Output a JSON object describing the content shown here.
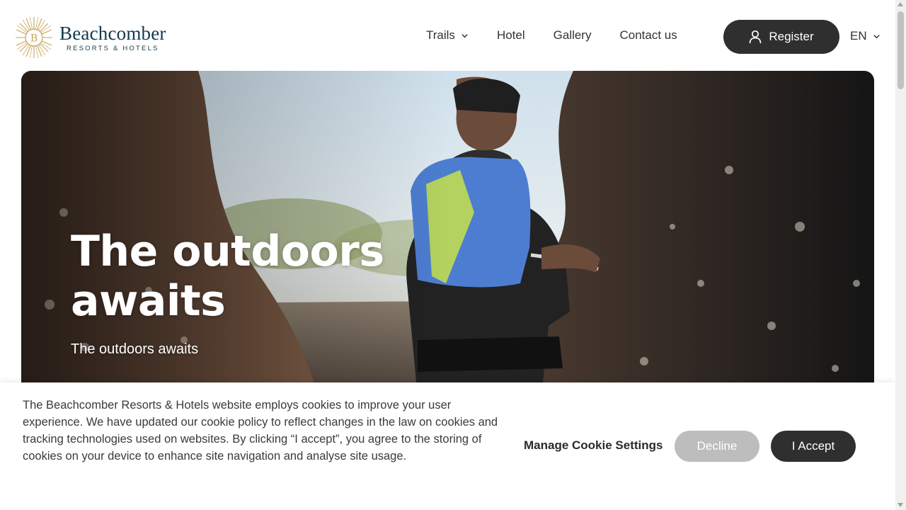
{
  "brand": {
    "name": "Beachcomber",
    "tagline": "RESORTS & HOTELS",
    "monogram": "B",
    "gold": "#c8a45a",
    "navy": "#123a4f"
  },
  "nav": {
    "items": [
      {
        "label": "Trails",
        "has_dropdown": true
      },
      {
        "label": "Hotel"
      },
      {
        "label": "Gallery"
      },
      {
        "label": "Contact us"
      }
    ],
    "register_label": "Register",
    "language": "EN"
  },
  "hero": {
    "title": "The outdoors awaits",
    "subtitle": "The outdoors awaits"
  },
  "cookie": {
    "text": "The Beachcomber Resorts & Hotels website employs cookies to improve your user experience. We have updated our cookie policy to reflect changes in the law on cookies and tracking technologies used on websites. By clicking “I accept”, you agree to the storing of cookies on your device to enhance site navigation and analyse site usage.",
    "manage_label": "Manage Cookie Settings",
    "decline_label": "Decline",
    "accept_label": "I Accept"
  },
  "colors": {
    "button_dark": "#2f2f2f",
    "button_disabled": "#bdbdbd"
  }
}
